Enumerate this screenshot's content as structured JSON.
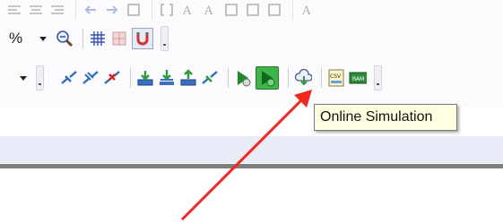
{
  "zoom": {
    "value": "%"
  },
  "tooltip": {
    "text": "Online Simulation"
  },
  "colors": {
    "accent_green": "#3fb44a",
    "arrow_red": "#f0281e",
    "tooltip_bg": "#ffffe1"
  },
  "icons": {
    "row1": [
      "align-icon",
      "align-icon",
      "align-icon",
      "arrow-left-icon",
      "arrow-right-icon",
      "frame-icon",
      "bracket-icon",
      "text-icon",
      "text-icon",
      "frame-icon",
      "frame-icon",
      "frame-icon",
      "text-icon"
    ],
    "row2": [
      "zoom-out-icon",
      "grid-icon",
      "snap-icon",
      "magnet-icon"
    ],
    "row3": [
      "connect-icon",
      "connect-all-icon",
      "disconnect-icon",
      "download-icon",
      "download-all-icon",
      "upload-icon",
      "connect-icon",
      "simulation-icon",
      "online-simulation-icon",
      "cloud-download-icon",
      "csv-icon",
      "ram-icon"
    ]
  }
}
